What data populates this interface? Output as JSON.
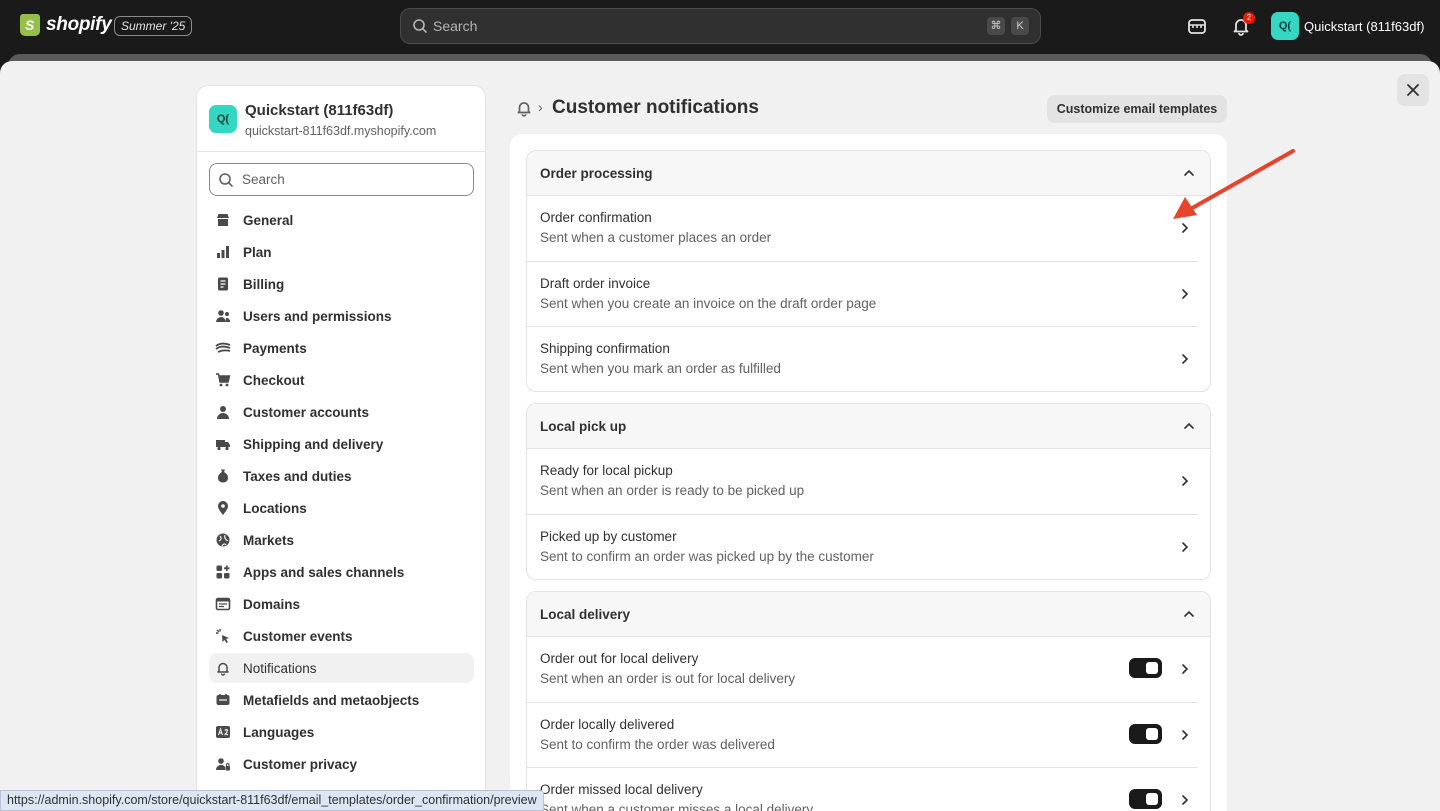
{
  "topbar": {
    "logo_text": "shopify",
    "edition": "Summer '25",
    "search_placeholder": "Search",
    "shortcut_mod": "⌘",
    "shortcut_key": "K",
    "notification_count": "2",
    "account_initials": "Q(",
    "account_name": "Quickstart (811f63df)"
  },
  "sidebar": {
    "store_initials": "Q(",
    "store_name": "Quickstart (811f63df)",
    "store_url": "quickstart-811f63df.myshopify.com",
    "search_placeholder": "Search",
    "items": [
      {
        "label": "General",
        "icon": "store-icon"
      },
      {
        "label": "Plan",
        "icon": "plan-icon"
      },
      {
        "label": "Billing",
        "icon": "billing-icon"
      },
      {
        "label": "Users and permissions",
        "icon": "users-icon"
      },
      {
        "label": "Payments",
        "icon": "payments-icon"
      },
      {
        "label": "Checkout",
        "icon": "cart-icon"
      },
      {
        "label": "Customer accounts",
        "icon": "person-icon"
      },
      {
        "label": "Shipping and delivery",
        "icon": "truck-icon"
      },
      {
        "label": "Taxes and duties",
        "icon": "tax-icon"
      },
      {
        "label": "Locations",
        "icon": "location-icon"
      },
      {
        "label": "Markets",
        "icon": "globe-icon"
      },
      {
        "label": "Apps and sales channels",
        "icon": "apps-icon"
      },
      {
        "label": "Domains",
        "icon": "domain-icon"
      },
      {
        "label": "Customer events",
        "icon": "events-icon"
      },
      {
        "label": "Notifications",
        "icon": "bell-icon",
        "active": true
      },
      {
        "label": "Metafields and metaobjects",
        "icon": "metafields-icon"
      },
      {
        "label": "Languages",
        "icon": "language-icon"
      },
      {
        "label": "Customer privacy",
        "icon": "privacy-icon"
      }
    ]
  },
  "header": {
    "page_title": "Customer notifications",
    "customize_button": "Customize email templates"
  },
  "sections": [
    {
      "title": "Order processing",
      "rows": [
        {
          "title": "Order confirmation",
          "desc": "Sent when a customer places an order"
        },
        {
          "title": "Draft order invoice",
          "desc": "Sent when you create an invoice on the draft order page"
        },
        {
          "title": "Shipping confirmation",
          "desc": "Sent when you mark an order as fulfilled"
        }
      ]
    },
    {
      "title": "Local pick up",
      "rows": [
        {
          "title": "Ready for local pickup",
          "desc": "Sent when an order is ready to be picked up"
        },
        {
          "title": "Picked up by customer",
          "desc": "Sent to confirm an order was picked up by the customer"
        }
      ]
    },
    {
      "title": "Local delivery",
      "rows": [
        {
          "title": "Order out for local delivery",
          "desc": "Sent when an order is out for local delivery",
          "toggle": true
        },
        {
          "title": "Order locally delivered",
          "desc": "Sent to confirm the order was delivered",
          "toggle": true
        },
        {
          "title": "Order missed local delivery",
          "desc": "Sent when a customer misses a local delivery",
          "toggle": true
        }
      ]
    }
  ],
  "status_url": "https://admin.shopify.com/store/quickstart-811f63df/email_templates/order_confirmation/preview",
  "colors": {
    "accent_avatar": "#36d7c2",
    "annotation_arrow": "#e8432b",
    "badge": "#e51c00"
  }
}
